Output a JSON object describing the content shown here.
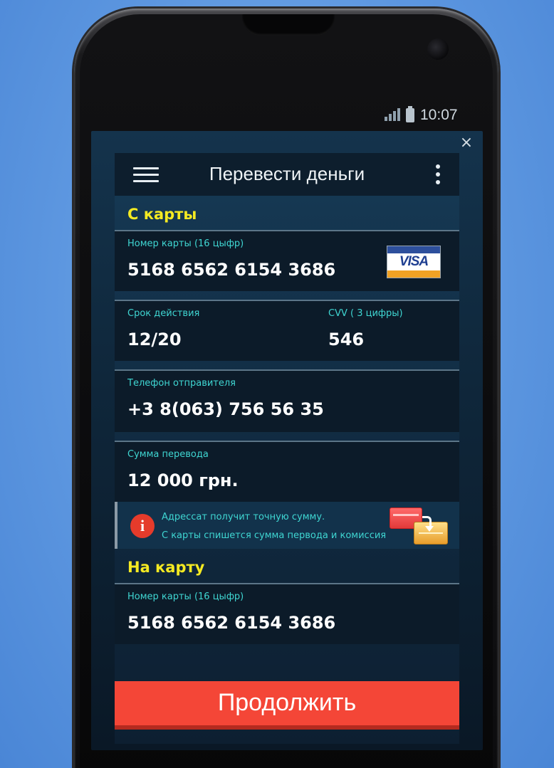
{
  "status_bar": {
    "time": "10:07",
    "signal_icon": "signal-icon",
    "battery_icon": "battery-icon"
  },
  "dialog": {
    "close_label": "×"
  },
  "app_bar": {
    "title": "Перевести деньги",
    "menu_icon": "hamburger-menu-icon",
    "more_icon": "more-vert-icon"
  },
  "from_card": {
    "section_title": "С карты",
    "card_number": {
      "label": "Номер карты (16 цыфр)",
      "value": "5168 6562 6154 3686",
      "brand": "VISA"
    },
    "expiry": {
      "label": "Срок действия",
      "value": "12/20"
    },
    "cvv": {
      "label": "CVV ( 3 цифры)",
      "value": "546"
    },
    "sender_phone": {
      "label": "Телефон отправителя",
      "value": "+3 8(063) 756 56 35"
    },
    "amount": {
      "label": "Сумма перевода",
      "value": "12 000 грн."
    }
  },
  "info": {
    "line1": "Адрессат получит точную сумму.",
    "line2": "С карты  спишется сумма первода и комиссия"
  },
  "to_card": {
    "section_title": "На карту",
    "card_number": {
      "label": "Номер карты (16 цыфр)",
      "value": "5168 6562 6154 3686"
    }
  },
  "continue_button": "Продолжить",
  "colors": {
    "accent_yellow": "#f5ea22",
    "label_cyan": "#3fd6d2",
    "button_red": "#f44637"
  }
}
